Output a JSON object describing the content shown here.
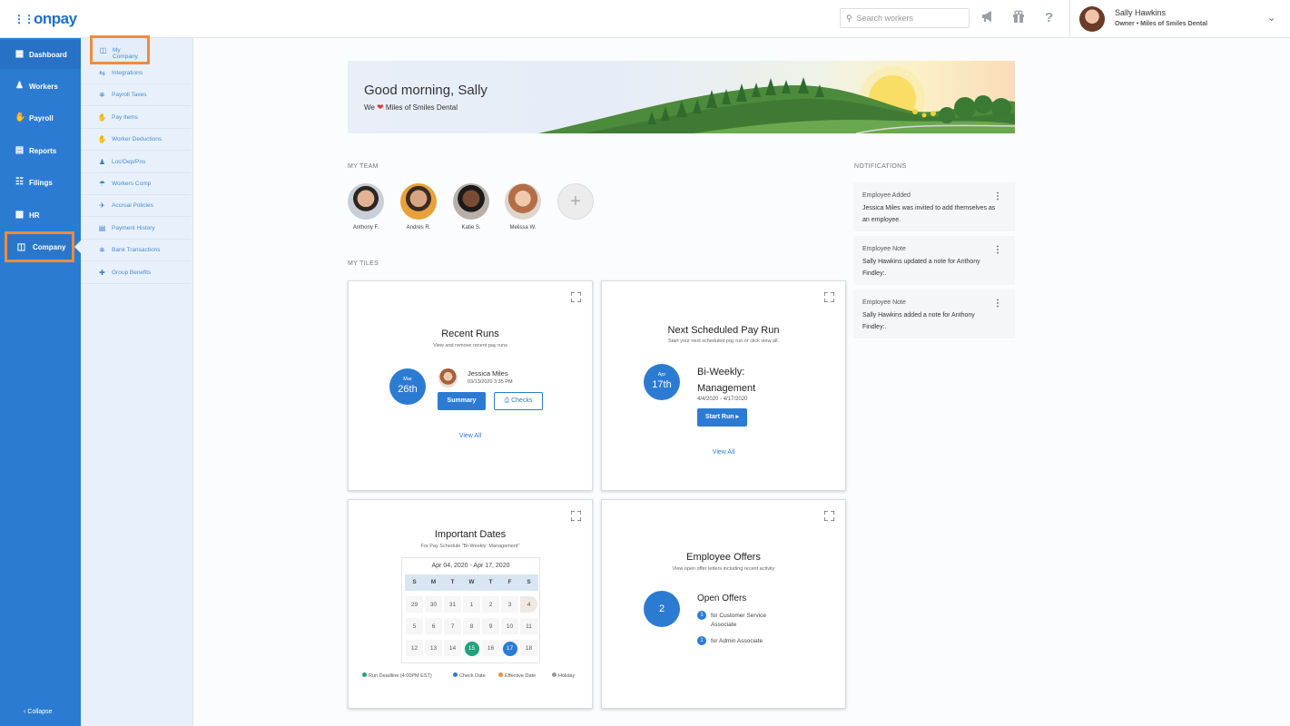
{
  "brand": {
    "logo": "onpay"
  },
  "header": {
    "search_placeholder": "Search workers",
    "icons": [
      "megaphone-icon",
      "gift-icon",
      "help-icon"
    ],
    "help_glyph": "?",
    "user": {
      "name": "Sally Hawkins",
      "role": "Owner • Miles of Smiles Dental"
    }
  },
  "leftnav": {
    "items": [
      {
        "label": "Dashboard",
        "icon": "dashboard-icon"
      },
      {
        "label": "Workers",
        "icon": "workers-icon"
      },
      {
        "label": "Payroll",
        "icon": "payroll-icon"
      },
      {
        "label": "Reports",
        "icon": "reports-icon"
      },
      {
        "label": "Filings",
        "icon": "filings-icon"
      },
      {
        "label": "HR",
        "icon": "hr-icon"
      },
      {
        "label": "Company",
        "icon": "company-icon"
      }
    ],
    "collapse": "‹ Collapse"
  },
  "subnav": {
    "items": [
      {
        "label": "My Company"
      },
      {
        "label": "Integrations"
      },
      {
        "label": "Payroll Taxes"
      },
      {
        "label": "Pay Items"
      },
      {
        "label": "Worker Deductions"
      },
      {
        "label": "Loc/Dep/Pos"
      },
      {
        "label": "Workers Comp"
      },
      {
        "label": "Accrual Policies"
      },
      {
        "label": "Payment History"
      },
      {
        "label": "Bank Transactions"
      },
      {
        "label": "Group Benefits"
      }
    ]
  },
  "banner": {
    "greeting": "Good morning, Sally",
    "sub_pre": "We",
    "sub_post": "Miles of Smiles Dental"
  },
  "team": {
    "label": "MY TEAM",
    "members": [
      {
        "name": "Anthony F."
      },
      {
        "name": "Andres R."
      },
      {
        "name": "Katie S."
      },
      {
        "name": "Melissa W."
      }
    ],
    "add_glyph": "+"
  },
  "tiles_label": "MY TILES",
  "recent_runs": {
    "title": "Recent Runs",
    "subtitle": "View and remove recent pay runs",
    "month": "Mar",
    "day": "26th",
    "worker": "Jessica Miles",
    "datetime": "03/13/2020 3:35 PM",
    "summary": "Summary",
    "checks": "Checks",
    "view_all": "View All"
  },
  "next_run": {
    "title": "Next Scheduled Pay Run",
    "subtitle": "Start your next scheduled pay run or click view all.",
    "month": "Apr",
    "day": "17th",
    "schedule_line1": "Bi-Weekly:",
    "schedule_line2": "Management",
    "range": "4/4/2020 - 4/17/2020",
    "start": "Start Run ▸",
    "view_all": "View All"
  },
  "important_dates": {
    "title": "Important Dates",
    "subtitle": "For Pay Schedule \"Bi-Weekly: Management\"",
    "range": "Apr 04, 2020 - Apr 17, 2020",
    "weekdays": [
      "S",
      "M",
      "T",
      "W",
      "T",
      "F",
      "S"
    ],
    "weeks": [
      [
        "29",
        "30",
        "31",
        "1",
        "2",
        "3",
        "4"
      ],
      [
        "5",
        "6",
        "7",
        "8",
        "9",
        "10",
        "11"
      ],
      [
        "12",
        "13",
        "14",
        "15",
        "16",
        "17",
        "18"
      ]
    ],
    "legend": [
      "Run Deadline (4:00PM EST)",
      "Check Date",
      "Effective Date",
      "Holiday"
    ],
    "colors": {
      "run_deadline": "#1fa37a",
      "check_date": "#2c7bd3",
      "effective_date": "#f08b3c",
      "holiday": "#9a9a9a"
    }
  },
  "employee_offers": {
    "title": "Employee Offers",
    "subtitle": "View open offer letters including recent activity",
    "count": "2",
    "heading": "Open Offers",
    "offers": [
      {
        "badge": "1",
        "text": "for Customer Service Associate"
      },
      {
        "badge": "1",
        "text": "for Admin Associate"
      }
    ]
  },
  "notifications": {
    "label": "NOTIFICATIONS",
    "items": [
      {
        "type": "Employee Added",
        "text": "Jessica Miles was invited to add themselves as an employee."
      },
      {
        "type": "Employee Note",
        "text": "Sally Hawkins updated a note for Anthony Findley:."
      },
      {
        "type": "Employee Note",
        "text": "Sally Hawkins added a note for Anthony Findley:."
      }
    ]
  }
}
